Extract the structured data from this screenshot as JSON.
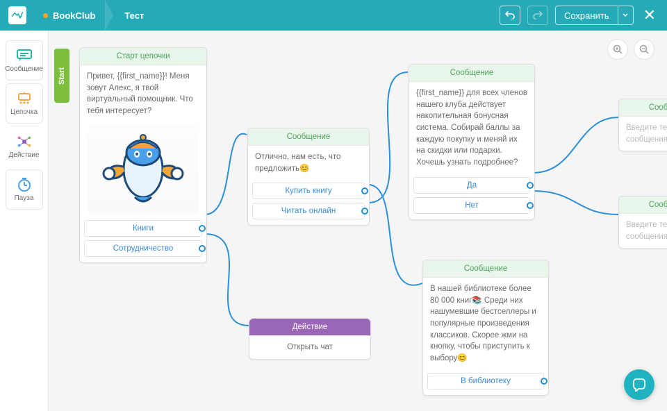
{
  "header": {
    "breadcrumb1": "BookClub",
    "breadcrumb2": "Тест",
    "save_label": "Сохранить"
  },
  "sidebar": {
    "items": [
      {
        "label": "Сообщение"
      },
      {
        "label": "Цепочка"
      },
      {
        "label": "Действие"
      },
      {
        "label": "Пауза"
      }
    ]
  },
  "start_tab": "Start",
  "nodes": {
    "start": {
      "title": "Старт цепочки",
      "body": "Привет, {{first_name}}!\nМеня зовут Алекс, я твой виртуальный помощник. Что тебя интересует?",
      "options": [
        {
          "label": "Книги"
        },
        {
          "label": "Сотрудничество"
        }
      ]
    },
    "msg_offer": {
      "title": "Сообщение",
      "body": "Отлично, нам есть, что предложить😊",
      "options": [
        {
          "label": "Купить книгу"
        },
        {
          "label": "Читать онлайн"
        }
      ]
    },
    "msg_bonus": {
      "title": "Сообщение",
      "body": "{{first_name}} для всех членов нашего клуба действует накопительная бонусная система. Собирай баллы за каждую покупку и меняй их на скидки или подарки. Хочешь узнать подробнее?",
      "options": [
        {
          "label": "Да"
        },
        {
          "label": "Нет"
        }
      ]
    },
    "msg_library": {
      "title": "Сообщение",
      "body": "В нашей библиотеке более 80 000 книг📚 Среди них нашумевшие бестселлеры и популярные произведения классиков. Скорее жми на кнопку, чтобы приступить к выбору😊",
      "options": [
        {
          "label": "В библиотеку"
        }
      ]
    },
    "action_chat": {
      "title": "Действие",
      "body": "Открыть чат"
    },
    "msg_empty1": {
      "title": "Сообщение",
      "placeholder": "Введите текст сообщения"
    },
    "msg_empty2": {
      "title": "Сообщение",
      "placeholder": "Введите текст сообщения"
    }
  }
}
